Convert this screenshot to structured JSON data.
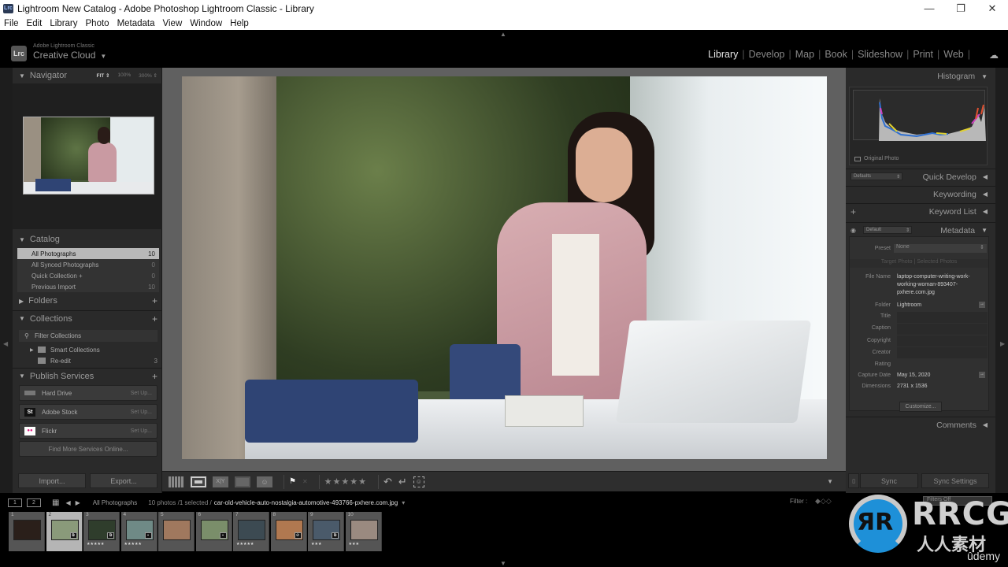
{
  "window": {
    "title": "Lightroom New Catalog - Adobe Photoshop Lightroom Classic - Library",
    "app_icon": "Lrc",
    "controls": {
      "minimize": "—",
      "maximize": "❐",
      "close": "✕"
    }
  },
  "menubar": [
    "File",
    "Edit",
    "Library",
    "Photo",
    "Metadata",
    "View",
    "Window",
    "Help"
  ],
  "identity": {
    "logo": "Lrc",
    "product": "Adobe Lightroom Classic",
    "plate": "Creative Cloud",
    "caret": "▼"
  },
  "modules": {
    "items": [
      "Library",
      "Develop",
      "Map",
      "Book",
      "Slideshow",
      "Print",
      "Web"
    ],
    "active": "Library",
    "cloud_icon": "☁"
  },
  "left_panel": {
    "navigator": {
      "title": "Navigator",
      "zoom_options": [
        "FIT ⇕",
        "100%",
        "300% ⇕"
      ],
      "selected_zoom": "FIT"
    },
    "catalog": {
      "title": "Catalog",
      "items": [
        {
          "label": "All Photographs",
          "count": "10",
          "selected": true
        },
        {
          "label": "All Synced Photographs",
          "count": "0"
        },
        {
          "label": "Quick Collection +",
          "count": "0"
        },
        {
          "label": "Previous Import",
          "count": "10"
        }
      ]
    },
    "folders": {
      "title": "Folders",
      "add": "+"
    },
    "collections": {
      "title": "Collections",
      "add": "+",
      "filter_placeholder": "Filter Collections",
      "items": [
        {
          "label": "Smart Collections",
          "count": ""
        },
        {
          "label": "Re-edit",
          "count": "3"
        }
      ]
    },
    "publish_services": {
      "title": "Publish Services",
      "add": "+",
      "services": [
        {
          "name": "Hard Drive",
          "action": "Set Up..."
        },
        {
          "name": "Adobe Stock",
          "icon": "St",
          "action": "Set Up..."
        },
        {
          "name": "Flickr",
          "icon": "●●",
          "action": "Set Up..."
        }
      ],
      "find_more": "Find More Services Online..."
    },
    "import_label": "Import...",
    "export_label": "Export..."
  },
  "right_panel": {
    "histogram": {
      "title": "Histogram",
      "original_photo": "Original Photo"
    },
    "quick_develop": {
      "title": "Quick Develop",
      "preset": "Defaults"
    },
    "keywording": {
      "title": "Keywording"
    },
    "keyword_list": {
      "title": "Keyword List",
      "add": "+"
    },
    "metadata": {
      "title": "Metadata",
      "preset_select": "Default",
      "preset_label": "Preset",
      "preset_value": "None",
      "tabs": [
        "Target Photo",
        "Selected Photos"
      ],
      "fields": [
        {
          "label": "File Name",
          "value": "laptop-computer-writing-work-working-woman-893407-pxhere.com.jpg"
        },
        {
          "label": "Folder",
          "value": "Lightroom"
        },
        {
          "label": "Title",
          "value": ""
        },
        {
          "label": "Caption",
          "value": ""
        },
        {
          "label": "Copyright",
          "value": ""
        },
        {
          "label": "Creator",
          "value": ""
        },
        {
          "label": "Rating",
          "value": ""
        },
        {
          "label": "Capture Date",
          "value": "May 15, 2020"
        },
        {
          "label": "Dimensions",
          "value": "2731 x 1536"
        }
      ],
      "customize_label": "Customize..."
    },
    "comments": {
      "title": "Comments"
    },
    "sync_label": "Sync",
    "sync_settings_label": "Sync Settings"
  },
  "toolbar": {
    "views": [
      "grid-view",
      "loupe-view",
      "compare-view",
      "survey-view",
      "people-view"
    ],
    "compare_label": "X|Y",
    "rating_stars": "★★★★★",
    "rotate_left": "↶",
    "rotate_right": "↵"
  },
  "filmstrip_bar": {
    "page1": "1",
    "page2": "2",
    "source": "All Photographs",
    "count_info": "10 photos /1 selected /",
    "current_file": "car-old-vehicle-auto-nostalgia-automotive-493766-pxhere.com.jpg",
    "caret": "▾",
    "filter_label": "Filter :",
    "filters_off": "Filters Off"
  },
  "filmstrip": [
    {
      "num": "1",
      "stars": "",
      "badge": "",
      "color": "#2a1f1a"
    },
    {
      "num": "2",
      "stars": "",
      "badge": "⧉",
      "color": "#8a9a7a",
      "selected": true
    },
    {
      "num": "3",
      "stars": "★★★★★",
      "badge": "⧉",
      "color": "#2f3d2c"
    },
    {
      "num": "4",
      "stars": "★★★★★",
      "badge": "▪",
      "color": "#6f8a86"
    },
    {
      "num": "5",
      "stars": "",
      "badge": "",
      "color": "#a0785e"
    },
    {
      "num": "6",
      "stars": "",
      "badge": "▪",
      "color": "#7a8e6a"
    },
    {
      "num": "7",
      "stars": "★★★★★",
      "badge": "",
      "color": "#3c4a52"
    },
    {
      "num": "8",
      "stars": "",
      "badge": "⊘",
      "color": "#b07850"
    },
    {
      "num": "9",
      "stars": "★★★",
      "badge": "⧉",
      "color": "#4a5a6a"
    },
    {
      "num": "10",
      "stars": "★★★",
      "badge": "",
      "color": "#9a8a80"
    }
  ],
  "watermark": {
    "brand": "RRCG",
    "chinese": "人人素材",
    "platform": "ûdemy"
  }
}
